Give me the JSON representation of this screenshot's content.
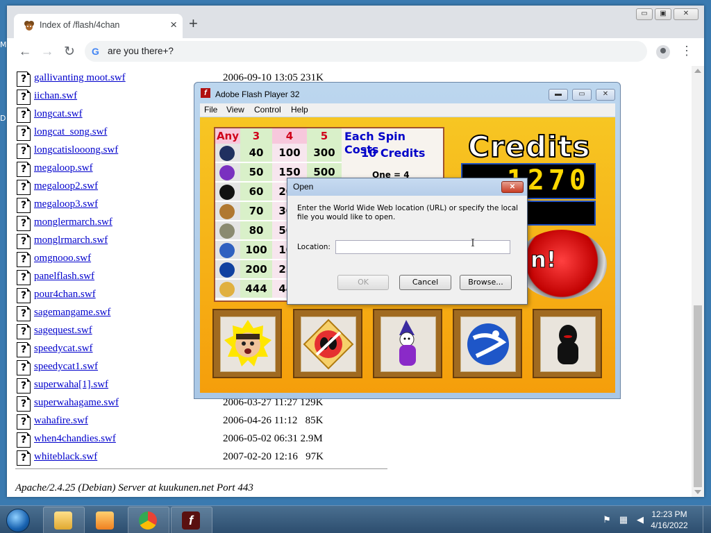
{
  "desktop": {
    "left_fragments": [
      "M",
      "D"
    ]
  },
  "chrome": {
    "tab": {
      "title": "Index of /flash/4chan",
      "close": "×"
    },
    "newtab": "+",
    "window_controls": [
      "▭",
      "▣",
      "✕"
    ],
    "nav": {
      "back": "←",
      "forward": "→",
      "reload": "↻"
    },
    "omnibox": {
      "g": "G",
      "text": "are you there+?"
    },
    "menu": "⋮"
  },
  "listing": {
    "icon_glyph": "?",
    "rows": [
      {
        "name": "gallivanting moot.swf",
        "meta": "2006-09-10 13:05 231K"
      },
      {
        "name": "iichan.swf",
        "meta": ""
      },
      {
        "name": "longcat.swf",
        "meta": ""
      },
      {
        "name": "longcat_song.swf",
        "meta": ""
      },
      {
        "name": "longcatislooong.swf",
        "meta": ""
      },
      {
        "name": "megaloop.swf",
        "meta": ""
      },
      {
        "name": "megaloop2.swf",
        "meta": ""
      },
      {
        "name": "megaloop3.swf",
        "meta": ""
      },
      {
        "name": "monglermarch.swf",
        "meta": ""
      },
      {
        "name": "monglrmarch.swf",
        "meta": ""
      },
      {
        "name": "omgnooo.swf",
        "meta": ""
      },
      {
        "name": "panelflash.swf",
        "meta": ""
      },
      {
        "name": "pour4chan.swf",
        "meta": ""
      },
      {
        "name": "sagemangame.swf",
        "meta": ""
      },
      {
        "name": "sagequest.swf",
        "meta": ""
      },
      {
        "name": "speedycat.swf",
        "meta": ""
      },
      {
        "name": "speedycat1.swf",
        "meta": ""
      },
      {
        "name": "superwaha[1].swf",
        "meta": ""
      },
      {
        "name": "superwahagame.swf",
        "meta": "2006-03-27 11:27 129K"
      },
      {
        "name": "wahafire.swf",
        "meta": "2006-04-26 11:12   85K"
      },
      {
        "name": "when4chandies.swf",
        "meta": "2006-05-02 06:31 2.9M"
      },
      {
        "name": "whiteblack.swf",
        "meta": "2007-02-20 12:16   97K"
      }
    ],
    "address": "Apache/2.4.25 (Debian) Server at kuukunen.net Port 443"
  },
  "flash": {
    "title": "Adobe Flash Player 32",
    "icon": "f",
    "controls": [
      "▬",
      "▭",
      "✕"
    ],
    "menu": [
      "File",
      "View",
      "Control",
      "Help"
    ],
    "game": {
      "headers": [
        "Any",
        "3",
        "4",
        "5"
      ],
      "rows": [
        {
          "c3": "40",
          "c4": "100",
          "c5": "300"
        },
        {
          "c3": "50",
          "c4": "150",
          "c5": "500"
        },
        {
          "c3": "60",
          "c4": "200",
          "c5": ""
        },
        {
          "c3": "70",
          "c4": "300",
          "c5": ""
        },
        {
          "c3": "80",
          "c4": "500",
          "c5": ""
        },
        {
          "c3": "100",
          "c4": "100",
          "c5": ""
        },
        {
          "c3": "200",
          "c4": "250",
          "c5": ""
        },
        {
          "c3": "444",
          "c4": "444",
          "c5": ""
        }
      ],
      "cost_line1": "Each Spin Costs",
      "cost_line2": "10 Credits",
      "cost_line3": "One = 4 credits",
      "credits_label": "Credits",
      "credits_value": "1270",
      "spin_label": "n!"
    }
  },
  "dialog": {
    "title": "Open",
    "close": "✕",
    "message": "Enter the World Wide Web location (URL) or specify the local file you would like to open.",
    "location_label": "Location:",
    "location_value": "",
    "buttons": {
      "ok": "OK",
      "cancel": "Cancel",
      "browse": "Browse..."
    }
  },
  "taskbar": {
    "clock_time": "12:23 PM",
    "clock_date": "4/16/2022"
  }
}
